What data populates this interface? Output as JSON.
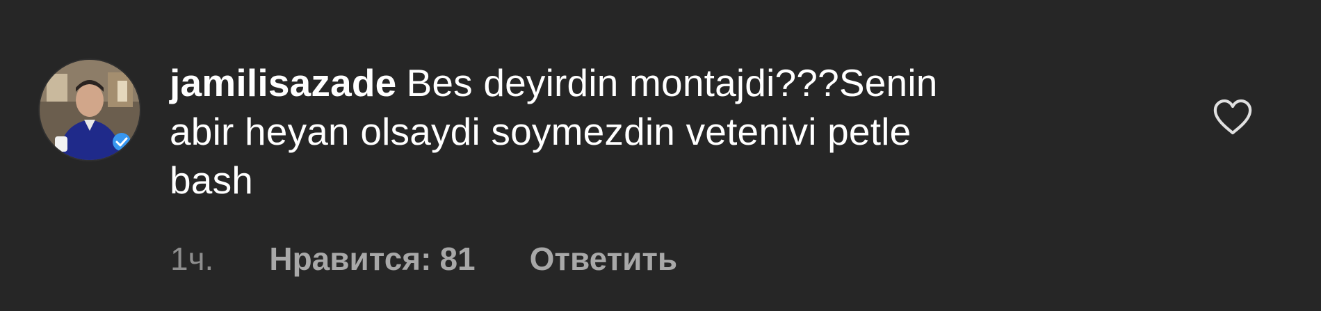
{
  "comment": {
    "username": "jamilisazade",
    "text_line1": "Bes deyirdin montajdi???Senin",
    "text_line2": "abir heyan olsaydi soymezdin vetenivi petle",
    "text_line3": "bash",
    "time": "1ч.",
    "likes_label": "Нравится:",
    "likes_count": "81",
    "reply_label": "Ответить"
  },
  "icons": {
    "like": "heart-outline-icon",
    "verified": "verified-badge-icon"
  },
  "colors": {
    "background": "#262626",
    "primary_text": "#ffffff",
    "secondary_text": "#a8a8a8",
    "verified": "#3897f0"
  }
}
